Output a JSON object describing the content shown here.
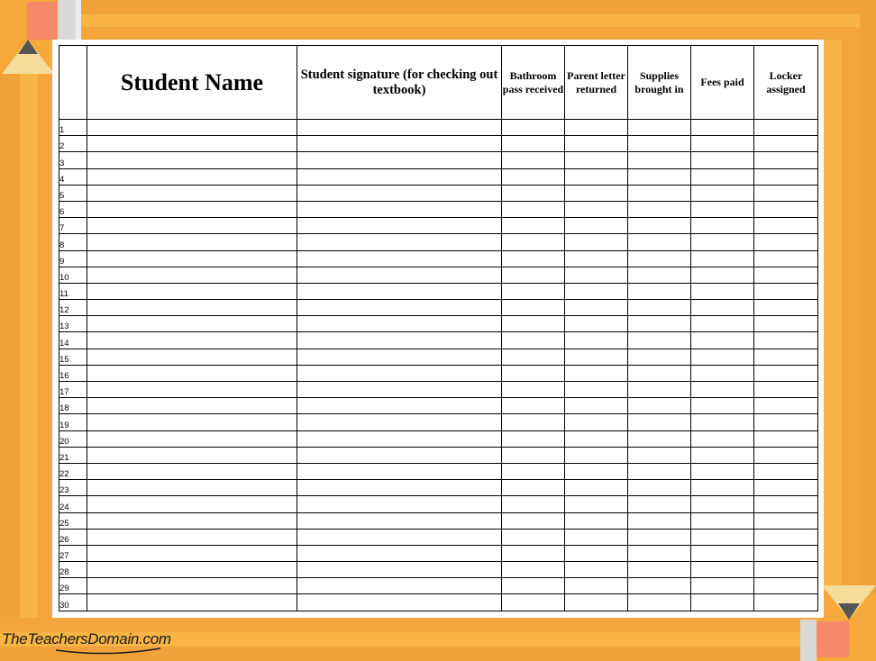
{
  "table": {
    "headers": {
      "student_name": "Student Name",
      "student_signature": "Student signature (for checking out textbook)",
      "bathroom_pass": "Bathroom pass received",
      "parent_letter": "Parent letter returned",
      "supplies": "Supplies brought in",
      "fees_paid": "Fees paid",
      "locker": "Locker assigned"
    },
    "row_numbers": [
      "1",
      "2",
      "3",
      "4",
      "5",
      "6",
      "7",
      "8",
      "9",
      "10",
      "11",
      "12",
      "13",
      "14",
      "15",
      "16",
      "17",
      "18",
      "19",
      "20",
      "21",
      "22",
      "23",
      "24",
      "25",
      "26",
      "27",
      "28",
      "29",
      "30"
    ]
  },
  "branding": {
    "site": "TheTeachersDomain.com"
  },
  "colors": {
    "frame_orange": "#f6a83a",
    "eraser_pink": "#f7896b",
    "pencil_tip": "#f6dc9a",
    "lead_gray": "#555555"
  }
}
